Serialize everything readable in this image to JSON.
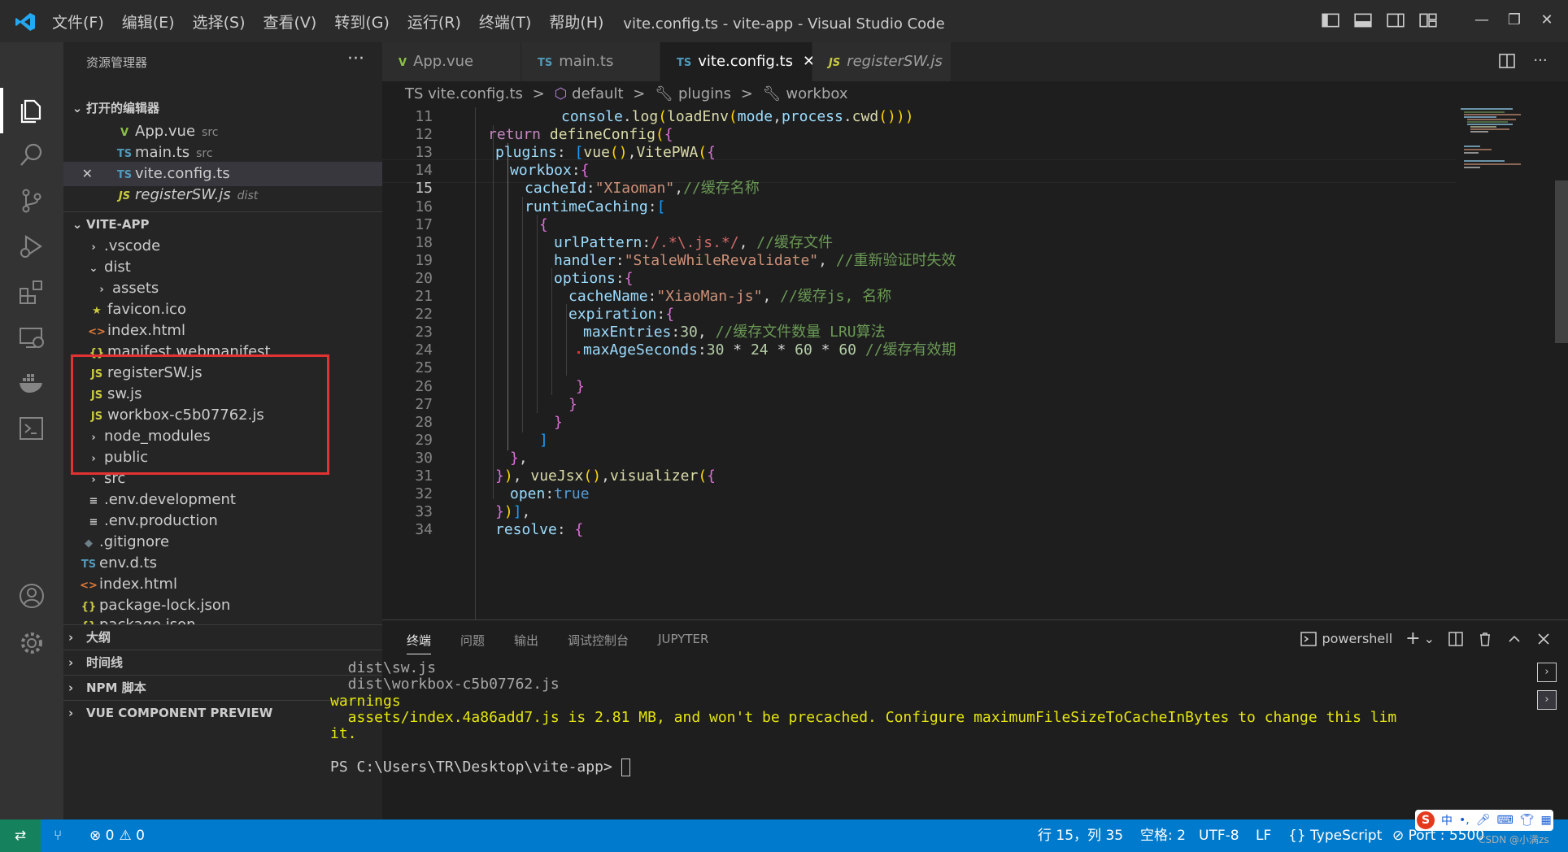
{
  "window": {
    "title": "vite.config.ts - vite-app - Visual Studio Code",
    "menu": [
      "文件(F)",
      "编辑(E)",
      "选择(S)",
      "查看(V)",
      "转到(G)",
      "运行(R)",
      "终端(T)",
      "帮助(H)"
    ],
    "controls": [
      "—",
      "❐",
      "✕"
    ]
  },
  "activity_bar": [
    "files-icon",
    "search-icon",
    "source-control-icon",
    "run-debug-icon",
    "extensions-icon",
    "remote-explorer-icon",
    "docker-icon",
    "terminal-icon",
    "account-icon",
    "settings-gear-icon"
  ],
  "sidebar": {
    "title": "资源管理器",
    "more": "···",
    "open_editors": {
      "header": "打开的编辑器",
      "items": [
        {
          "type": "vue",
          "name": "App.vue",
          "desc": "src"
        },
        {
          "type": "ts",
          "name": "main.ts",
          "desc": "src"
        },
        {
          "type": "ts",
          "name": "vite.config.ts",
          "desc": "",
          "close": "✕"
        },
        {
          "type": "js",
          "name": "registerSW.js",
          "desc": "dist"
        }
      ]
    },
    "project": {
      "header": "VITE-APP",
      "items": [
        {
          "name": ".vscode",
          "kind": "folder",
          "expanded": false
        },
        {
          "name": "dist",
          "kind": "folder",
          "expanded": true
        },
        {
          "name": "assets",
          "kind": "folder",
          "expanded": false
        },
        {
          "name": "favicon.ico",
          "kind": "file",
          "icon": "★"
        },
        {
          "name": "index.html",
          "kind": "file",
          "icon": "<>"
        },
        {
          "name": "manifest.webmanifest",
          "kind": "file",
          "icon": "{}"
        },
        {
          "name": "registerSW.js",
          "kind": "file",
          "icon": "JS"
        },
        {
          "name": "sw.js",
          "kind": "file",
          "icon": "JS"
        },
        {
          "name": "workbox-c5b07762.js",
          "kind": "file",
          "icon": "JS"
        },
        {
          "name": "node_modules",
          "kind": "folder",
          "expanded": false
        },
        {
          "name": "public",
          "kind": "folder",
          "expanded": false
        },
        {
          "name": "src",
          "kind": "folder",
          "expanded": false
        },
        {
          "name": ".env.development",
          "kind": "file",
          "icon": "≡"
        },
        {
          "name": ".env.production",
          "kind": "file",
          "icon": "≡"
        },
        {
          "name": ".gitignore",
          "kind": "file",
          "icon": "◆"
        },
        {
          "name": "env.d.ts",
          "kind": "file",
          "icon": "TS"
        },
        {
          "name": "index.html",
          "kind": "file",
          "icon": "<>"
        },
        {
          "name": "package-lock.json",
          "kind": "file",
          "icon": "{}"
        },
        {
          "name": "package.json",
          "kind": "file",
          "icon": "{}"
        }
      ]
    },
    "bottom_sections": [
      "大纲",
      "时间线",
      "NPM 脚本",
      "VUE COMPONENT PREVIEW"
    ]
  },
  "tabs": [
    {
      "icon": "V",
      "label": "App.vue",
      "active": false
    },
    {
      "icon": "TS",
      "label": "main.ts",
      "active": false
    },
    {
      "icon": "TS",
      "label": "vite.config.ts",
      "active": true,
      "close": "✕"
    },
    {
      "icon": "JS",
      "label": "registerSW.js",
      "active": false
    }
  ],
  "tab_actions": [
    "split-editor-icon",
    "···"
  ],
  "breadcrumb": [
    "TS vite.config.ts",
    ">",
    "default",
    ">",
    "plugins",
    ">",
    "workbox"
  ],
  "editor": {
    "current_line": 15,
    "lines": [
      {
        "n": "11",
        "text": "console.log(loadEnv(mode,process.cwd()))"
      },
      {
        "n": "12",
        "text": "return defineConfig({"
      },
      {
        "n": "13",
        "text": "plugins: [vue(),VitePWA({"
      },
      {
        "n": "14",
        "text": "workbox:{"
      },
      {
        "n": "15",
        "text": "cacheId:\"XIaoman\",//缓存名称"
      },
      {
        "n": "16",
        "text": "runtimeCaching:["
      },
      {
        "n": "17",
        "text": "{"
      },
      {
        "n": "18",
        "text": "urlPattern:/.*\\.js.*/, //缓存文件"
      },
      {
        "n": "19",
        "text": "handler:\"StaleWhileRevalidate\", //重新验证时失效"
      },
      {
        "n": "20",
        "text": "options:{"
      },
      {
        "n": "21",
        "text": "cacheName:\"XiaoMan-js\", //缓存js, 名称"
      },
      {
        "n": "22",
        "text": "expiration:{"
      },
      {
        "n": "23",
        "text": "maxEntries:30, //缓存文件数量 LRU算法"
      },
      {
        "n": "24",
        "text": "maxAgeSeconds:30 * 24 * 60 * 60 //缓存有效期"
      },
      {
        "n": "25",
        "text": ""
      },
      {
        "n": "26",
        "text": "}"
      },
      {
        "n": "27",
        "text": "}"
      },
      {
        "n": "28",
        "text": "}"
      },
      {
        "n": "29",
        "text": "]"
      },
      {
        "n": "30",
        "text": "},"
      },
      {
        "n": "31",
        "text": "}), vueJsx(),visualizer({"
      },
      {
        "n": "32",
        "text": "open:true"
      },
      {
        "n": "33",
        "text": "})],"
      },
      {
        "n": "34",
        "text": "resolve: {"
      }
    ]
  },
  "panel": {
    "tabs": [
      "终端",
      "问题",
      "输出",
      "调试控制台",
      "JUPYTER"
    ],
    "shell": "powershell",
    "actions": [
      "+",
      "⌄",
      "split-terminal-icon",
      "trash-icon",
      "chevron-up-icon",
      "close-icon"
    ],
    "terminal_lines": [
      {
        "style": "dim",
        "text": "  dist\\sw.js"
      },
      {
        "style": "dim",
        "text": "  dist\\workbox-c5b07762.js"
      },
      {
        "style": "warn",
        "text": "warnings"
      },
      {
        "style": "warn",
        "text": "  assets/index.4a86add7.js is 2.81 MB, and won't be precached. Configure maximumFileSizeToCacheInBytes to change this lim"
      },
      {
        "style": "warn",
        "text": "it."
      },
      {
        "style": "plain",
        "text": ""
      },
      {
        "style": "plain",
        "text": "PS C:\\Users\\TR\\Desktop\\vite-app> "
      }
    ]
  },
  "statusbar": {
    "errors": "0",
    "warnings": "0",
    "position": "行 15，列 35",
    "spaces": "空格: 2",
    "encoding": "UTF-8",
    "eol": "LF",
    "language": "{} TypeScript",
    "port": "Port : 5500"
  },
  "ime": {
    "logo": "S",
    "mode": "中"
  },
  "watermark": "CSDN @小满zs",
  "colors": {
    "statusbar": "#007acc",
    "highlight_box": "#e23232",
    "remote": "#16825d"
  }
}
